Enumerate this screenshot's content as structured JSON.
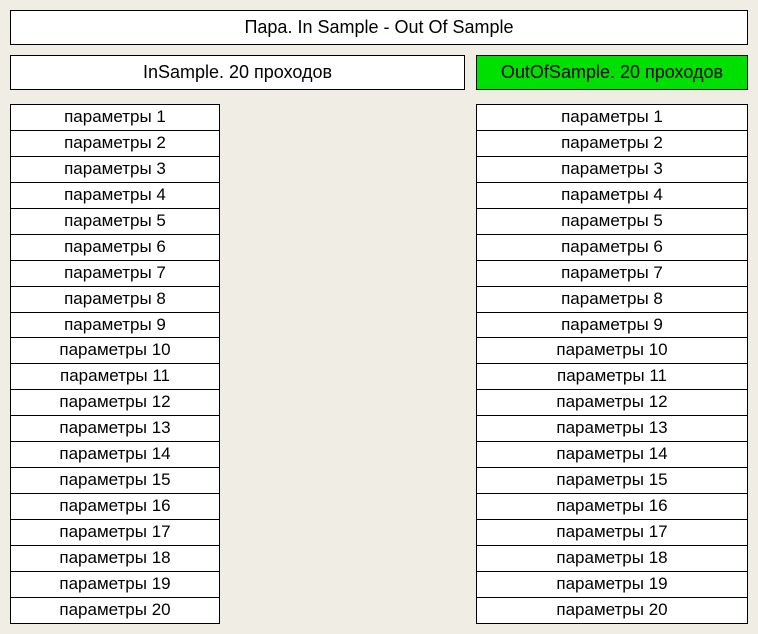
{
  "title": "Пара. In Sample - Out Of Sample",
  "left": {
    "header": "InSample. 20 проходов",
    "items": [
      "параметры 1",
      "параметры 2",
      "параметры 3",
      "параметры 4",
      "параметры 5",
      "параметры 6",
      "параметры 7",
      "параметры 8",
      "параметры 9",
      "параметры 10",
      "параметры 11",
      "параметры 12",
      "параметры 13",
      "параметры 14",
      "параметры 15",
      "параметры 16",
      "параметры 17",
      "параметры 18",
      "параметры 19",
      "параметры 20"
    ]
  },
  "right": {
    "header": "OutOfSample. 20 проходов",
    "items": [
      "параметры 1",
      "параметры 2",
      "параметры 3",
      "параметры 4",
      "параметры 5",
      "параметры 6",
      "параметры 7",
      "параметры 8",
      "параметры 9",
      "параметры 10",
      "параметры 11",
      "параметры 12",
      "параметры 13",
      "параметры 14",
      "параметры 15",
      "параметры 16",
      "параметры 17",
      "параметры 18",
      "параметры 19",
      "параметры 20"
    ]
  }
}
